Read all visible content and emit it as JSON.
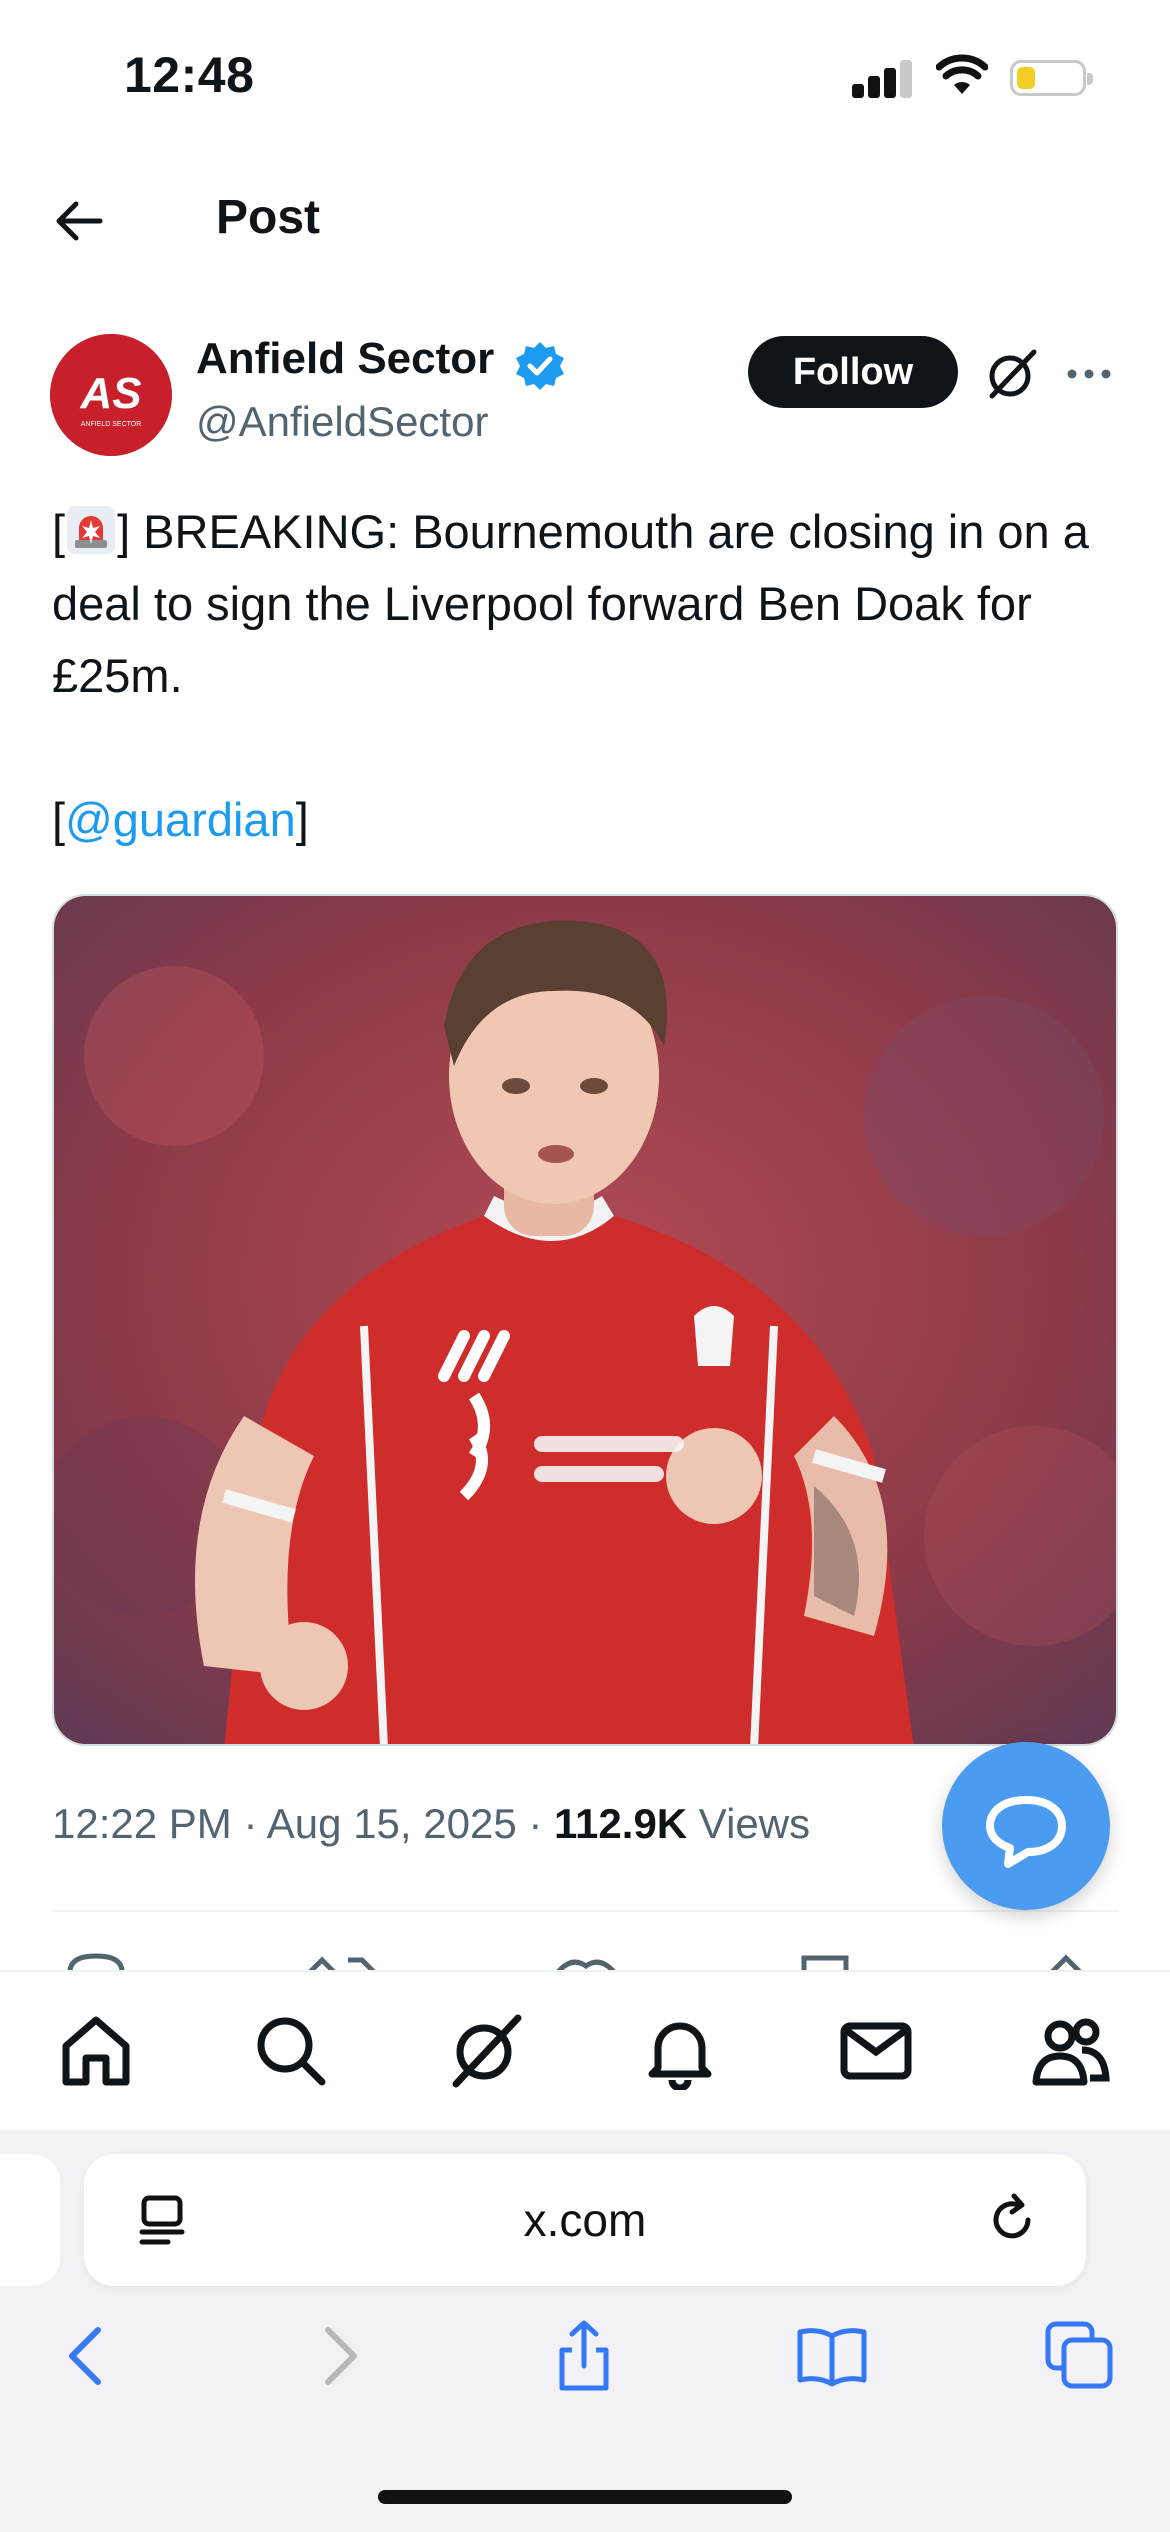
{
  "status_bar": {
    "time": "12:48"
  },
  "header": {
    "title": "Post"
  },
  "post": {
    "author_name": "Anfield Sector",
    "handle": "@AnfieldSector",
    "follow_label": "Follow",
    "text_bracket_open": "[",
    "text_main": "] BREAKING: Bournemouth are closing in on a deal to sign the Liverpool forward Ben Doak for £25m.",
    "source_open": "[",
    "source_mention": "@guardian",
    "source_close": "]",
    "image_alt": "Liverpool player in red kit",
    "time": "12:22 PM",
    "separator": " · ",
    "date": "Aug 15, 2025",
    "views_count": "112.9K",
    "views_label": " Views"
  },
  "avatar": {
    "initials": "AS",
    "sub": "ANFIELD SECTOR"
  },
  "browser": {
    "url": "x.com"
  },
  "colors": {
    "accent": "#1d9bf0",
    "fab": "#4b9bf0",
    "avatar": "#c7202a",
    "safari_blue": "#3478f6"
  },
  "icons": {
    "tabs": [
      "home-icon",
      "search-icon",
      "grok-icon",
      "notifications-icon",
      "messages-icon",
      "communities-icon"
    ],
    "safari": [
      "back-icon",
      "forward-icon",
      "share-icon",
      "bookmarks-icon",
      "tabs-icon"
    ]
  }
}
